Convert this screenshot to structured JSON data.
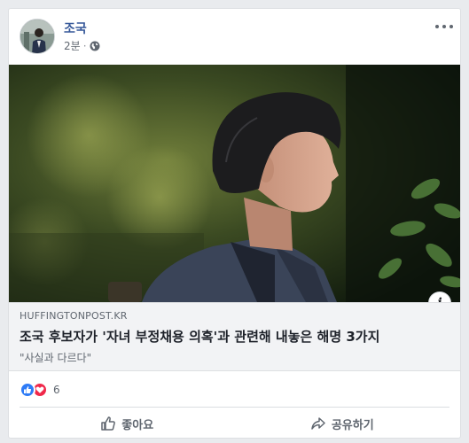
{
  "post": {
    "author": "조국",
    "timestamp": "2분",
    "separator": "·",
    "privacy_icon": "globe-icon",
    "more_icon": "more-options-icon"
  },
  "link": {
    "domain": "HUFFINGTONPOST.KR",
    "headline": "조국 후보자가 '자녀 부정채용 의혹'과 관련해 내놓은 해명 3가지",
    "description": "\"사실과 다르다\"",
    "info_label": "i"
  },
  "reactions": {
    "types": [
      "like",
      "love"
    ],
    "count": "6"
  },
  "actions": {
    "like_label": "좋아요",
    "share_label": "공유하기"
  },
  "colors": {
    "author": "#365899",
    "like_reaction": "#2e7bf6",
    "love_reaction": "#f0284a",
    "link_bg": "#f2f3f5"
  }
}
